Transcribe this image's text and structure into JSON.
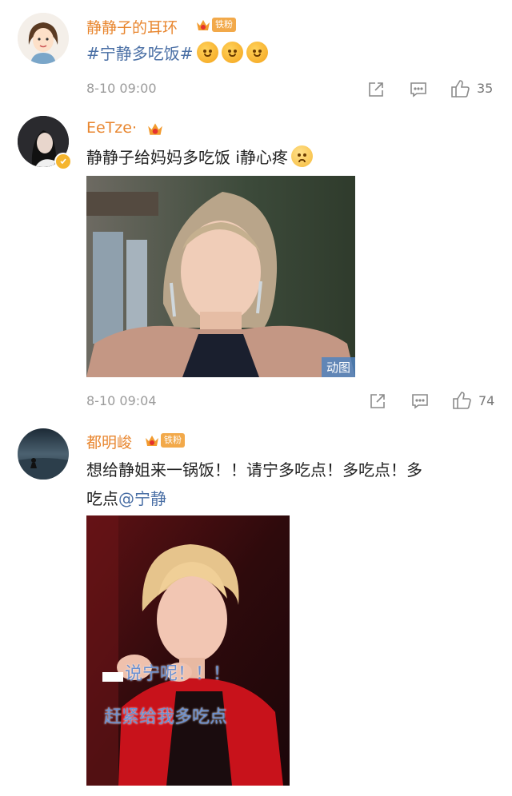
{
  "comments": [
    {
      "username": "静静子的耳环",
      "badge_label": "铁粉",
      "hashtag": "#宁静多吃饭#",
      "time": "8-10 09:00",
      "likes": "35",
      "emoji_icons": [
        "upside-down-face-icon",
        "upside-down-face-icon",
        "upside-down-face-icon"
      ]
    },
    {
      "username": "EeTze·",
      "text": "静静子给妈妈多吃饭 i静心疼",
      "time": "8-10 09:04",
      "likes": "74",
      "media_tag": "动图"
    },
    {
      "username": "都明峻",
      "badge_label": "铁粉",
      "text_line1": "想给静姐来一锅饭！！请宁多吃点！多吃点！多",
      "text_line2": "吃点",
      "mention": "@宁静",
      "caption_line1": "说宁呢！！！",
      "caption_line2": "赶紧给我多吃点"
    }
  ],
  "colors": {
    "username": "#e8862f",
    "link": "#4a6fa5",
    "meta": "#9b9b9b",
    "badge": "#f2a94a"
  }
}
